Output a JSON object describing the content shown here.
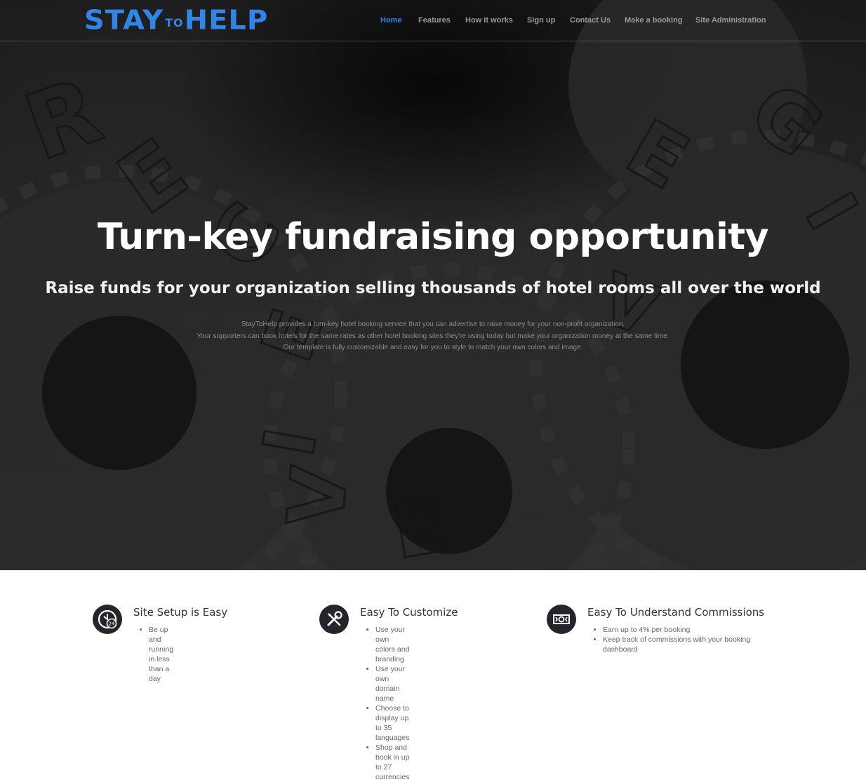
{
  "brand": {
    "logo_part1": "STAY",
    "logo_part2": "TO",
    "logo_part3": "HELP",
    "accent_color": "#2f86e8"
  },
  "nav": {
    "items": [
      {
        "label": "Home",
        "active": true
      },
      {
        "label": "Features"
      },
      {
        "label": "How it works"
      },
      {
        "label": "Sign up"
      },
      {
        "label": "Contact Us"
      },
      {
        "label": "Make a booking"
      },
      {
        "label": "Site Administration"
      }
    ]
  },
  "hero": {
    "title": "Turn-key fundraising opportunity",
    "subtitle": "Raise funds for your organization selling thousands of hotel rooms all over the world",
    "body": [
      "StayToHelp provides a turn-key hotel booking service that you can advertise to raise money for your non-profit organization.",
      "Your supporters can book hotels for the same rates as other hotel booking sites they're using today but make your organization money at the same time.",
      "Our template is fully customizable and easy for you to style to match your own colors and image."
    ],
    "background_letters": [
      "R",
      "E",
      "C",
      "E",
      "I",
      "V",
      "E",
      "G",
      "I",
      "V",
      "E"
    ]
  },
  "features": [
    {
      "icon": "clock-24-icon",
      "title": "Site Setup is Easy",
      "bullets": [
        "Be up and running in less than a day"
      ]
    },
    {
      "icon": "tools-icon",
      "title": "Easy To Customize",
      "bullets": [
        "Use your own colors and branding",
        "Use your own domain name",
        "Choose to display up to 35 languages",
        "Shop and book in up to 27 currencies"
      ]
    },
    {
      "icon": "money-icon",
      "title": "Easy To Understand Commissions",
      "bullets": [
        "Earn up to 4% per booking",
        "Keep track of commissions with your booking dashboard"
      ]
    }
  ]
}
